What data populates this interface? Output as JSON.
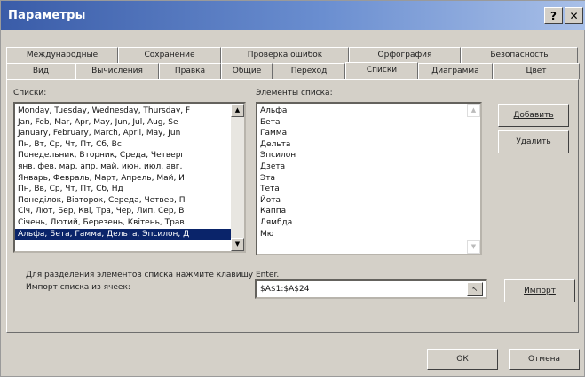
{
  "window": {
    "title": "Параметры",
    "help_glyph": "?",
    "close_glyph": "✕"
  },
  "tabs_top": [
    "Международные",
    "Сохранение",
    "Проверка ошибок",
    "Орфография",
    "Безопасность"
  ],
  "tabs_bottom": [
    "Вид",
    "Вычисления",
    "Правка",
    "Общие",
    "Переход",
    "Списки",
    "Диаграмма",
    "Цвет"
  ],
  "active_tab": "Списки",
  "lists": {
    "label": "Списки:",
    "items": [
      "Monday, Tuesday, Wednesday, Thursday, F",
      "Jan, Feb, Mar, Apr, May, Jun, Jul, Aug, Se",
      "January, February, March, April, May, Jun",
      "Пн, Вт, Ср, Чт, Пт, Сб, Вс",
      "Понедельник, Вторник, Среда, Четверг",
      "янв, фев, мар, апр, май, июн, июл, авг,",
      "Январь, Февраль, Март, Апрель, Май, И",
      "Пн, Вв, Ср, Чт, Пт, Сб, Нд",
      "Понеділок, Вівторок, Середа, Четвер, П",
      "Січ, Лют, Бер, Кві, Тра, Чер, Лип, Сер, В",
      "Січень, Лютий, Березень, Квітень, Трав",
      "Альфа, Бета, Гамма, Дельта, Эпсилон, Д"
    ],
    "selected_index": 11
  },
  "elements": {
    "label": "Элементы списка:",
    "items": [
      "Альфа",
      "Бета",
      "Гамма",
      "Дельта",
      "Эпсилон",
      "Дзета",
      "Эта",
      "Тета",
      "Йота",
      "Каппа",
      "Лямбда",
      "Мю"
    ]
  },
  "buttons": {
    "add": "Добавить",
    "delete": "Удалить",
    "import": "Импорт",
    "ok": "ОК",
    "cancel": "Отмена"
  },
  "hint": "Для разделения элементов списка нажмите клавишу Enter.",
  "import_label": "Импорт списка из ячеек:",
  "import_range": "$A$1:$A$24"
}
